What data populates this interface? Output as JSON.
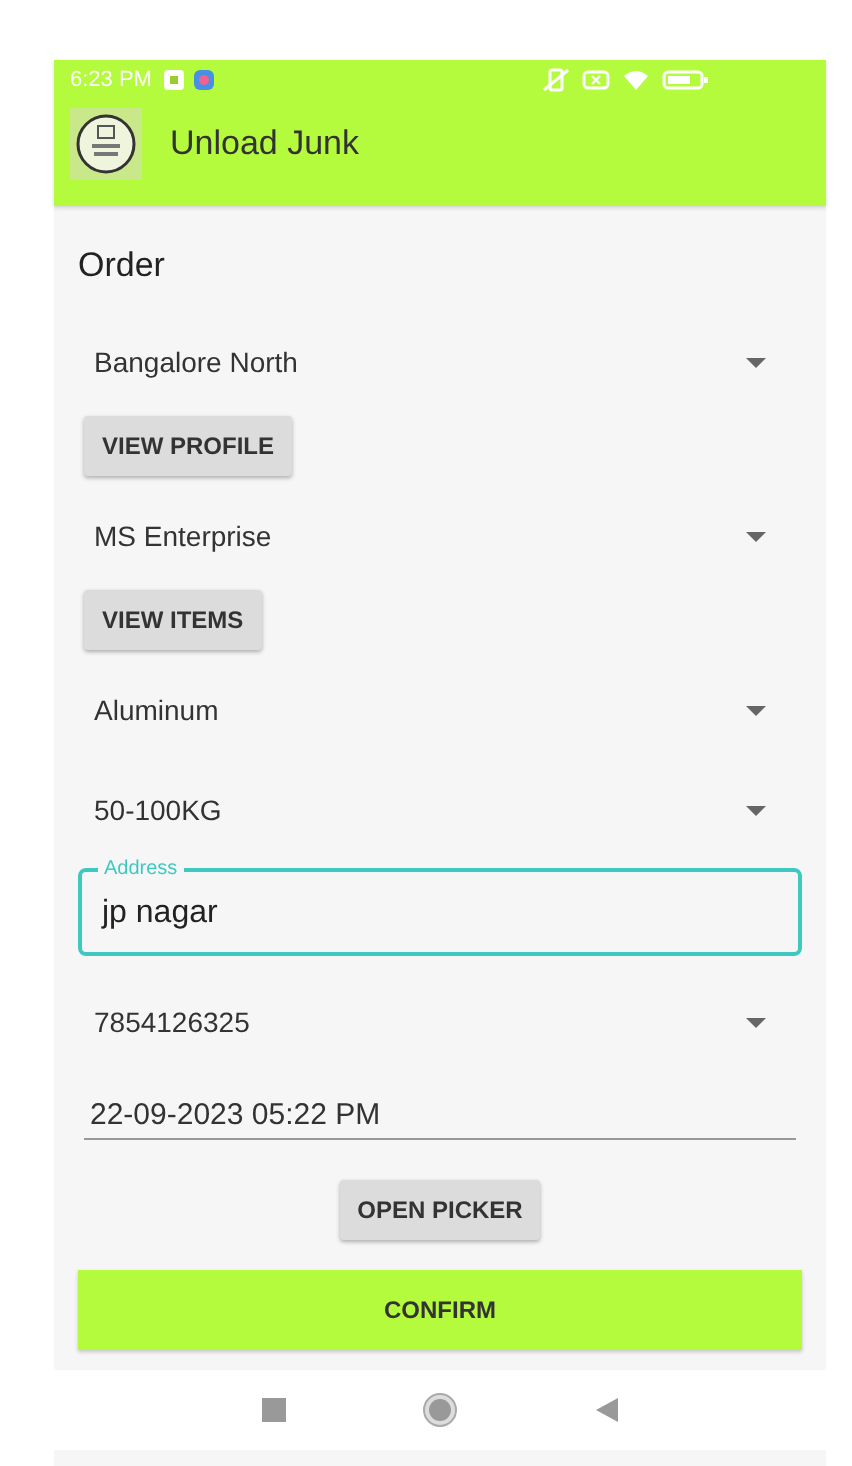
{
  "status_bar": {
    "time": "6:23 PM"
  },
  "app_bar": {
    "title": "Unload Junk"
  },
  "heading": "Order",
  "form": [
    {
      "kind": "spinner",
      "value": "Bangalore North"
    },
    {
      "kind": "button",
      "label": "VIEW PROFILE"
    },
    {
      "kind": "spinner",
      "value": "MS Enterprise"
    },
    {
      "kind": "button",
      "label": "VIEW ITEMS"
    },
    {
      "kind": "spinner",
      "value": "Aluminum"
    },
    {
      "kind": "spinner",
      "value": "50-100KG"
    },
    {
      "kind": "outlined-field",
      "label": "Address",
      "value": "jp nagar"
    },
    {
      "kind": "spinner",
      "value": "7854126325"
    },
    {
      "kind": "underlined-field",
      "value": "22-09-2023 05:22 PM"
    },
    {
      "kind": "center-button",
      "label": "OPEN PICKER"
    }
  ],
  "confirm_button": "CONFIRM"
}
